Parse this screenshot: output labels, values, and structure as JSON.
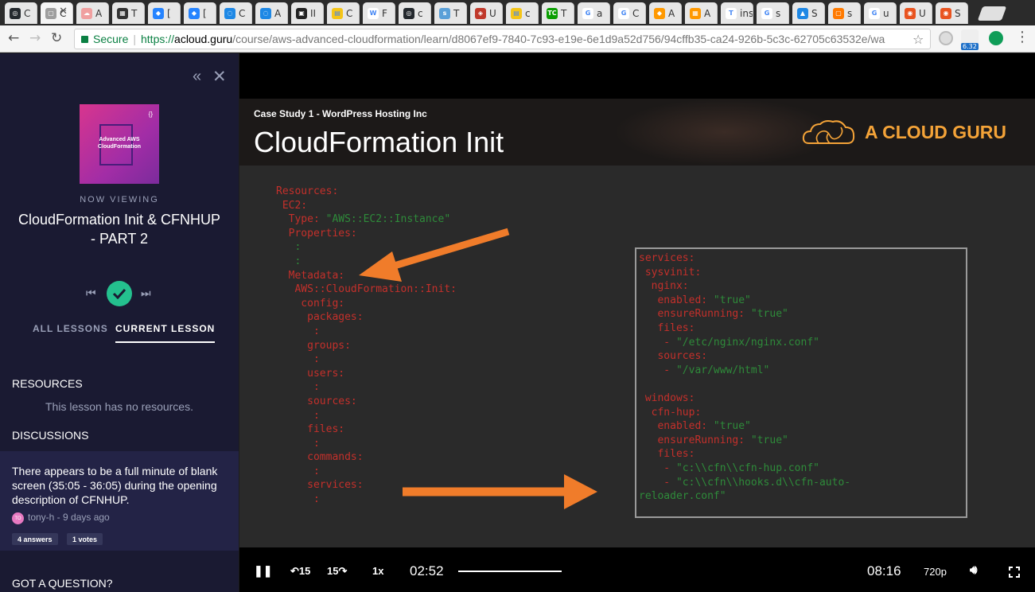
{
  "browser": {
    "tabs": [
      {
        "label": "C",
        "color": "#24292e",
        "glyph": "◎"
      },
      {
        "label": "C",
        "color": "#9e9e9e",
        "glyph": "▢"
      },
      {
        "label": "A",
        "color": "#f0a0a0",
        "glyph": "☁"
      },
      {
        "label": "T",
        "color": "#333333",
        "glyph": "▦"
      },
      {
        "label": "[",
        "color": "#2684ff",
        "glyph": "◆"
      },
      {
        "label": "[",
        "color": "#2684ff",
        "glyph": "◆"
      },
      {
        "label": "C",
        "color": "#1e88e5",
        "glyph": "◌"
      },
      {
        "label": "A",
        "color": "#1e88e5",
        "glyph": "◌"
      },
      {
        "label": "II",
        "color": "#222222",
        "glyph": "▣"
      },
      {
        "label": "C",
        "color": "#f5c518",
        "glyph": "▤"
      },
      {
        "label": "F",
        "color": "#ffffff",
        "glyph": "W"
      },
      {
        "label": "c",
        "color": "#24292e",
        "glyph": "◎"
      },
      {
        "label": "T",
        "color": "#5aa0d8",
        "glyph": "s"
      },
      {
        "label": "U",
        "color": "#c0392b",
        "glyph": "◈"
      },
      {
        "label": "c",
        "color": "#f5c518",
        "glyph": "▤"
      },
      {
        "label": "T",
        "color": "#0a9e01",
        "glyph": "TC"
      },
      {
        "label": "a",
        "color": "#ffffff",
        "glyph": "G"
      },
      {
        "label": "C",
        "color": "#ffffff",
        "glyph": "G"
      },
      {
        "label": "A",
        "color": "#ff9900",
        "glyph": "◆"
      },
      {
        "label": "A",
        "color": "#ff9900",
        "glyph": "▦"
      },
      {
        "label": "insi",
        "color": "#ffffff",
        "glyph": "T"
      },
      {
        "label": "s",
        "color": "#ffffff",
        "glyph": "G"
      },
      {
        "label": "S",
        "color": "#1e88e5",
        "glyph": "▲"
      },
      {
        "label": "s",
        "color": "#ff7a00",
        "glyph": "▢"
      },
      {
        "label": "u",
        "color": "#ffffff",
        "glyph": "G"
      },
      {
        "label": "U",
        "color": "#e95420",
        "glyph": "◉"
      },
      {
        "label": "S",
        "color": "#e95420",
        "glyph": "◉"
      }
    ],
    "address": {
      "secure_label": "Secure",
      "scheme": "https://",
      "host": "acloud.guru",
      "path": "/course/aws-advanced-cloudformation/learn/d8067ef9-7840-7c93-e19e-6e1d9a52d756/94cffb35-ca24-926b-5c3c-62705c63532e/wa"
    },
    "extension_badge": "6.32"
  },
  "sidebar": {
    "course_thumb_title": "Advanced AWS CloudFormation",
    "now_viewing_label": "NOW VIEWING",
    "lesson_title": "CloudFormation Init & CFNHUP - PART 2",
    "tabs": {
      "all": "ALL LESSONS",
      "current": "CURRENT LESSON"
    },
    "resources_heading": "RESOURCES",
    "resources_empty": "This lesson has no resources.",
    "discussions_heading": "DISCUSSIONS",
    "discussion": {
      "text": "There appears to be a full minute of blank screen (35:05 - 36:05) during the opening description of CFNHUP.",
      "avatar_initials": "TO",
      "meta": "tony-h - 9 days ago",
      "answers": "4 answers",
      "votes": "1 votes"
    },
    "question_heading": "GOT A QUESTION?"
  },
  "slide": {
    "case_study": "Case Study 1 - WordPress Hosting Inc",
    "title": "CloudFormation Init",
    "brand": "A CLOUD GURU",
    "code_left": [
      {
        "text": "Resources:",
        "color": "red"
      },
      {
        "text": " EC2:",
        "color": "red"
      },
      {
        "text": "  Type: \"AWS::EC2::Instance\"",
        "color": "mixed",
        "key": "  Type: ",
        "value": "\"AWS::EC2::Instance\""
      },
      {
        "text": "  Properties:",
        "color": "red"
      },
      {
        "text": "   :",
        "color": "grn"
      },
      {
        "text": "   :",
        "color": "grn"
      },
      {
        "text": "  Metadata:",
        "color": "red"
      },
      {
        "text": "   AWS::CloudFormation::Init:",
        "color": "red"
      },
      {
        "text": "    config:",
        "color": "red"
      },
      {
        "text": "     packages:",
        "color": "red"
      },
      {
        "text": "      :",
        "color": "red"
      },
      {
        "text": "     groups:",
        "color": "red"
      },
      {
        "text": "      :",
        "color": "red"
      },
      {
        "text": "     users:",
        "color": "red"
      },
      {
        "text": "      :",
        "color": "red"
      },
      {
        "text": "     sources:",
        "color": "red"
      },
      {
        "text": "      :",
        "color": "red"
      },
      {
        "text": "     files:",
        "color": "red"
      },
      {
        "text": "      :",
        "color": "red"
      },
      {
        "text": "     commands:",
        "color": "red"
      },
      {
        "text": "      :",
        "color": "red"
      },
      {
        "text": "     services:",
        "color": "red"
      },
      {
        "text": "      :",
        "color": "red"
      }
    ],
    "code_right": [
      {
        "key": "services:",
        "value": ""
      },
      {
        "key": " sysvinit:",
        "value": ""
      },
      {
        "key": "  nginx:",
        "value": ""
      },
      {
        "key": "   enabled: ",
        "value": "\"true\""
      },
      {
        "key": "   ensureRunning: ",
        "value": "\"true\""
      },
      {
        "key": "   files:",
        "value": ""
      },
      {
        "key": "    - ",
        "value": "\"/etc/nginx/nginx.conf\""
      },
      {
        "key": "   sources:",
        "value": ""
      },
      {
        "key": "    - ",
        "value": "\"/var/www/html\""
      },
      {
        "key": "",
        "value": ""
      },
      {
        "key": " windows:",
        "value": ""
      },
      {
        "key": "  cfn-hup:",
        "value": ""
      },
      {
        "key": "   enabled: ",
        "value": "\"true\""
      },
      {
        "key": "   ensureRunning: ",
        "value": "\"true\""
      },
      {
        "key": "   files:",
        "value": ""
      },
      {
        "key": "    - ",
        "value": "\"c:\\\\cfn\\\\cfn-hup.conf\""
      },
      {
        "key": "    - ",
        "value": "\"c:\\\\cfn\\\\hooks.d\\\\cfn-auto-"
      },
      {
        "key": "",
        "value": "reloader.conf\""
      }
    ]
  },
  "player": {
    "back_label": "15",
    "forward_label": "15",
    "speed": "1x",
    "current_time": "02:52",
    "total_time": "08:16",
    "quality": "720p",
    "progress": 0.347
  },
  "colors": {
    "accent_green": "#24c08e",
    "brand_orange": "#f4a338",
    "sidebar_bg": "#1a1a32",
    "arrow_orange": "#f07c2a"
  }
}
